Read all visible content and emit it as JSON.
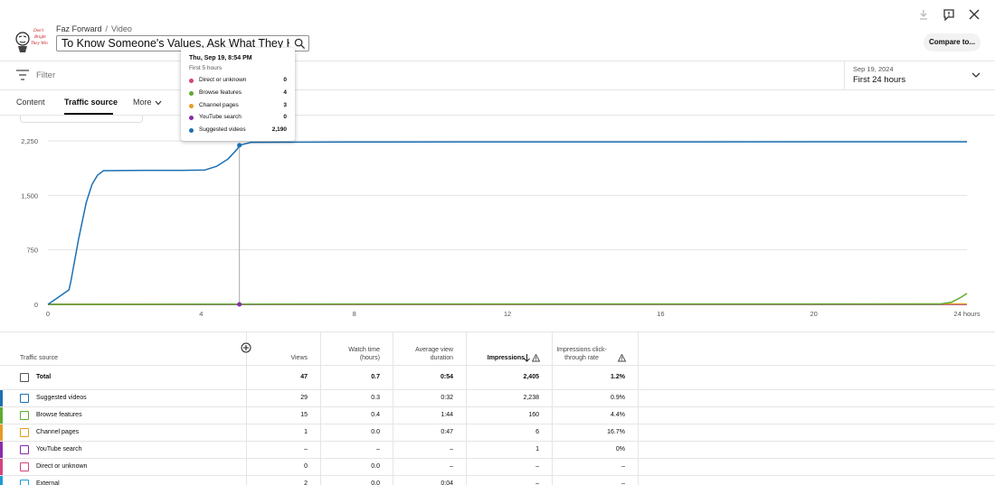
{
  "header": {
    "channel": "Faz Forward",
    "section": "Video",
    "video_title": "To Know Someone's Values, Ask What They Hate!",
    "compare_label": "Compare to..."
  },
  "filter": {
    "placeholder": "Filter"
  },
  "date_range": {
    "date": "Sep 19, 2024",
    "label": "First 24 hours"
  },
  "tabs": [
    {
      "label": "Content"
    },
    {
      "label": "Traffic source",
      "active": true
    },
    {
      "label": "More"
    }
  ],
  "tooltip": {
    "date": "Thu, Sep 19, 8:54 PM",
    "sub": "First 5 hours",
    "items": [
      {
        "name": "Direct or unknown",
        "value": "0",
        "color": "#d4447c"
      },
      {
        "name": "Browse features",
        "value": "4",
        "color": "#5faa30"
      },
      {
        "name": "Channel pages",
        "value": "3",
        "color": "#e59d25"
      },
      {
        "name": "YouTube search",
        "value": "0",
        "color": "#8a2bab"
      },
      {
        "name": "Suggested videos",
        "value": "2,190",
        "color": "#1b70b4"
      }
    ]
  },
  "chart_data": {
    "type": "line",
    "x_ticks": [
      "0",
      "4",
      "8",
      "12",
      "16",
      "20",
      "24 hours"
    ],
    "y_ticks": [
      "0",
      "750",
      "1,500",
      "2,250"
    ],
    "ylim": [
      0,
      2250
    ],
    "xlim": [
      0,
      24
    ],
    "grid": true,
    "series": [
      {
        "name": "Suggested videos",
        "color": "#1b70b4",
        "points": [
          [
            0,
            0
          ],
          [
            0.25,
            90
          ],
          [
            0.55,
            200
          ],
          [
            0.6,
            320
          ],
          [
            0.8,
            900
          ],
          [
            1.0,
            1400
          ],
          [
            1.15,
            1650
          ],
          [
            1.3,
            1780
          ],
          [
            1.45,
            1840
          ],
          [
            2.5,
            1845
          ],
          [
            3.5,
            1845
          ],
          [
            4.1,
            1850
          ],
          [
            4.4,
            1900
          ],
          [
            4.7,
            2000
          ],
          [
            4.95,
            2140
          ],
          [
            5.0,
            2190
          ],
          [
            5.3,
            2230
          ],
          [
            8.7,
            2235
          ],
          [
            24,
            2238
          ]
        ]
      },
      {
        "name": "Browse features",
        "color": "#5faa30",
        "points": [
          [
            0,
            0
          ],
          [
            1,
            0
          ],
          [
            4,
            2
          ],
          [
            5,
            4
          ],
          [
            23.3,
            5
          ],
          [
            23.6,
            30
          ],
          [
            23.85,
            100
          ],
          [
            24,
            150
          ]
        ]
      },
      {
        "name": "Channel pages",
        "color": "#e59d25",
        "points": [
          [
            0,
            0
          ],
          [
            4,
            2
          ],
          [
            5,
            3
          ],
          [
            24,
            6
          ]
        ]
      },
      {
        "name": "YouTube search",
        "color": "#8a2bab",
        "points": [
          [
            0,
            0
          ],
          [
            5,
            0
          ],
          [
            24,
            0
          ]
        ]
      },
      {
        "name": "Direct or unknown",
        "color": "#d4447c",
        "points": [
          [
            0,
            0
          ],
          [
            5,
            0
          ],
          [
            24,
            0
          ]
        ]
      }
    ],
    "hover_x": 5
  },
  "table": {
    "headers": [
      "Traffic source",
      "Views",
      "Watch time (hours)",
      "Average view duration",
      "Impressions",
      "Impressions click-through rate"
    ],
    "total": {
      "name": "Total",
      "views": "47",
      "watch": "0.7",
      "avd": "0:54",
      "impr": "2,405",
      "ctr": "1.2%"
    },
    "rows": [
      {
        "name": "Suggested videos",
        "color": "#1b70b4",
        "views": "29",
        "watch": "0.3",
        "avd": "0:32",
        "impr": "2,238",
        "ctr": "0.9%"
      },
      {
        "name": "Browse features",
        "color": "#5faa30",
        "views": "15",
        "watch": "0.4",
        "avd": "1:44",
        "impr": "160",
        "ctr": "4.4%"
      },
      {
        "name": "Channel pages",
        "color": "#e59d25",
        "views": "1",
        "watch": "0.0",
        "avd": "0:47",
        "impr": "6",
        "ctr": "16.7%"
      },
      {
        "name": "YouTube search",
        "color": "#8a2bab",
        "views": "–",
        "watch": "–",
        "avd": "–",
        "impr": "1",
        "ctr": "0%"
      },
      {
        "name": "Direct or unknown",
        "color": "#d4447c",
        "views": "0",
        "watch": "0.0",
        "avd": "–",
        "impr": "–",
        "ctr": "–"
      },
      {
        "name": "External",
        "color": "#1c9bd6",
        "views": "2",
        "watch": "0.0",
        "avd": "0:04",
        "impr": "–",
        "ctr": "–"
      }
    ]
  }
}
